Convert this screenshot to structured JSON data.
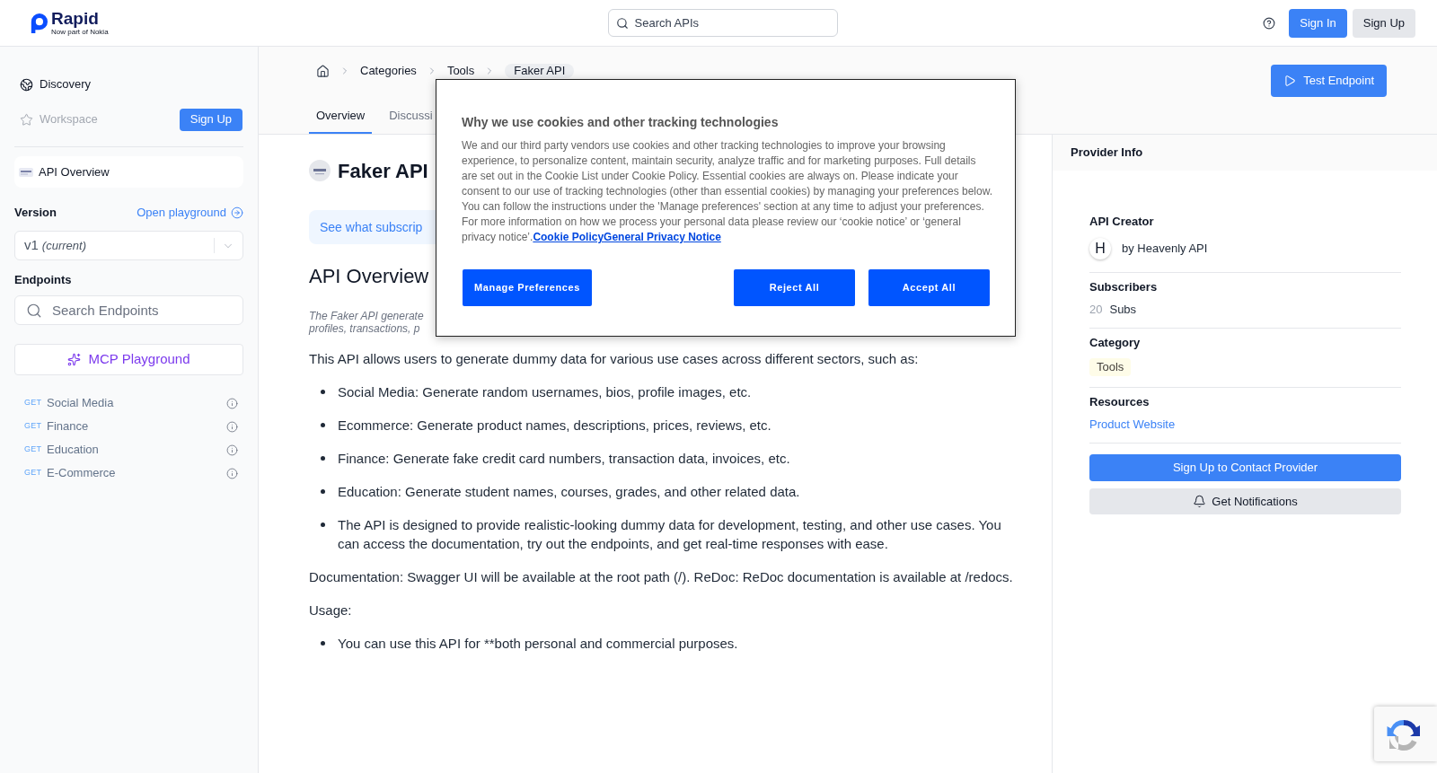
{
  "header": {
    "logo": {
      "name": "Rapid",
      "tagline": "Now part of Nokia"
    },
    "search": {
      "placeholder": "Search APIs"
    },
    "buttons": [
      {
        "label": "Sign In",
        "kind": "primary"
      },
      {
        "label": "Sign Up",
        "kind": "secondary"
      }
    ]
  },
  "sidebar": {
    "nav": [
      {
        "label": "Discovery",
        "kind": "discovery",
        "disabled": false
      },
      {
        "label": "Workspace",
        "kind": "workspace",
        "disabled": true,
        "action": "Sign Up"
      }
    ],
    "api_item": {
      "label": "API Overview"
    },
    "version": {
      "label": "Version",
      "link": "Open playground",
      "value": "v1",
      "note": "(current)"
    },
    "endpoints": {
      "label": "Endpoints",
      "search": {
        "placeholder": "Search Endpoints"
      },
      "playground_button": "MCP Playground",
      "items": [
        {
          "method": "GET",
          "name": "Social Media"
        },
        {
          "method": "GET",
          "name": "Finance"
        },
        {
          "method": "GET",
          "name": "Education"
        },
        {
          "method": "GET",
          "name": "E-Commerce"
        }
      ]
    }
  },
  "page_header": {
    "breadcrumb": [
      {
        "label": "Categories",
        "current": false
      },
      {
        "label": "Tools",
        "current": false
      },
      {
        "label": "Faker API",
        "current": true
      }
    ],
    "tabs": [
      {
        "label": "Overview",
        "selected": true
      },
      {
        "label": "Discussi",
        "selected": false
      }
    ],
    "action_button": "Test Endpoint"
  },
  "overview": {
    "title": "Faker API",
    "banner": "See what subscrip",
    "heading": "API Overview",
    "description_lines": [
      "The Faker API generate",
      "profiles, transactions, p"
    ],
    "blocks": [
      {
        "kind": "paragraph",
        "text": "This API allows users to generate dummy data for various use cases across different sectors, such as:"
      },
      {
        "kind": "bullets",
        "items": [
          "Social Media: Generate random usernames, bios, profile images, etc.",
          "Ecommerce: Generate product names, descriptions, prices, reviews, etc.",
          "Finance: Generate fake credit card numbers, transaction data, invoices, etc.",
          "Education: Generate student names, courses, grades, and other related data.",
          "The API is designed to provide realistic-looking dummy data for development, testing, and other use cases. You can access the documentation, try out the endpoints, and get real-time responses with ease."
        ]
      },
      {
        "kind": "paragraph",
        "text": "Documentation: Swagger UI will be available at the root path (/). ReDoc: ReDoc documentation is available at /redocs."
      },
      {
        "kind": "paragraph",
        "text": "Usage:"
      },
      {
        "kind": "bullets",
        "items": [
          "You can use this API for **both personal and commercial purposes."
        ]
      }
    ]
  },
  "provider_info": {
    "title": "Provider Info",
    "sections": [
      {
        "kind": "creator",
        "heading": "API Creator",
        "initial": "H",
        "text": "by Heavenly API"
      },
      {
        "kind": "subscribers",
        "heading": "Subscribers",
        "count": "20",
        "unit": "Subs"
      },
      {
        "kind": "category",
        "heading": "Category",
        "tag": "Tools"
      },
      {
        "kind": "resources",
        "heading": "Resources",
        "link": "Product Website"
      }
    ],
    "buttons": [
      {
        "label": "Sign Up to Contact Provider",
        "kind": "primary"
      },
      {
        "label": "Get Notifications",
        "kind": "secondary"
      }
    ]
  },
  "cookie_dialog": {
    "title": "Why we use cookies and other tracking technologies",
    "body": "We and our third party vendors use cookies and other tracking technologies to improve your browsing experience, to personalize content, maintain security, analyze traffic and for marketing purposes. Full details are set out in the Cookie List under Cookie Policy. Essential cookies are always on. Please indicate your consent to our use of tracking technologies (other than essential cookies) by managing your preferences below. You can follow the instructions under the 'Manage preferences' section at any time to adjust your preferences. For more information on how we process your personal data please review our ‘cookie notice’ or ‘general privacy notice’.",
    "links": [
      "Cookie Policy",
      "General Privacy Notice"
    ],
    "buttons": [
      {
        "label": "Manage Preferences",
        "kind": "preferences"
      },
      {
        "label": "Reject All",
        "kind": "reject"
      },
      {
        "label": "Accept All",
        "kind": "accept"
      }
    ]
  }
}
